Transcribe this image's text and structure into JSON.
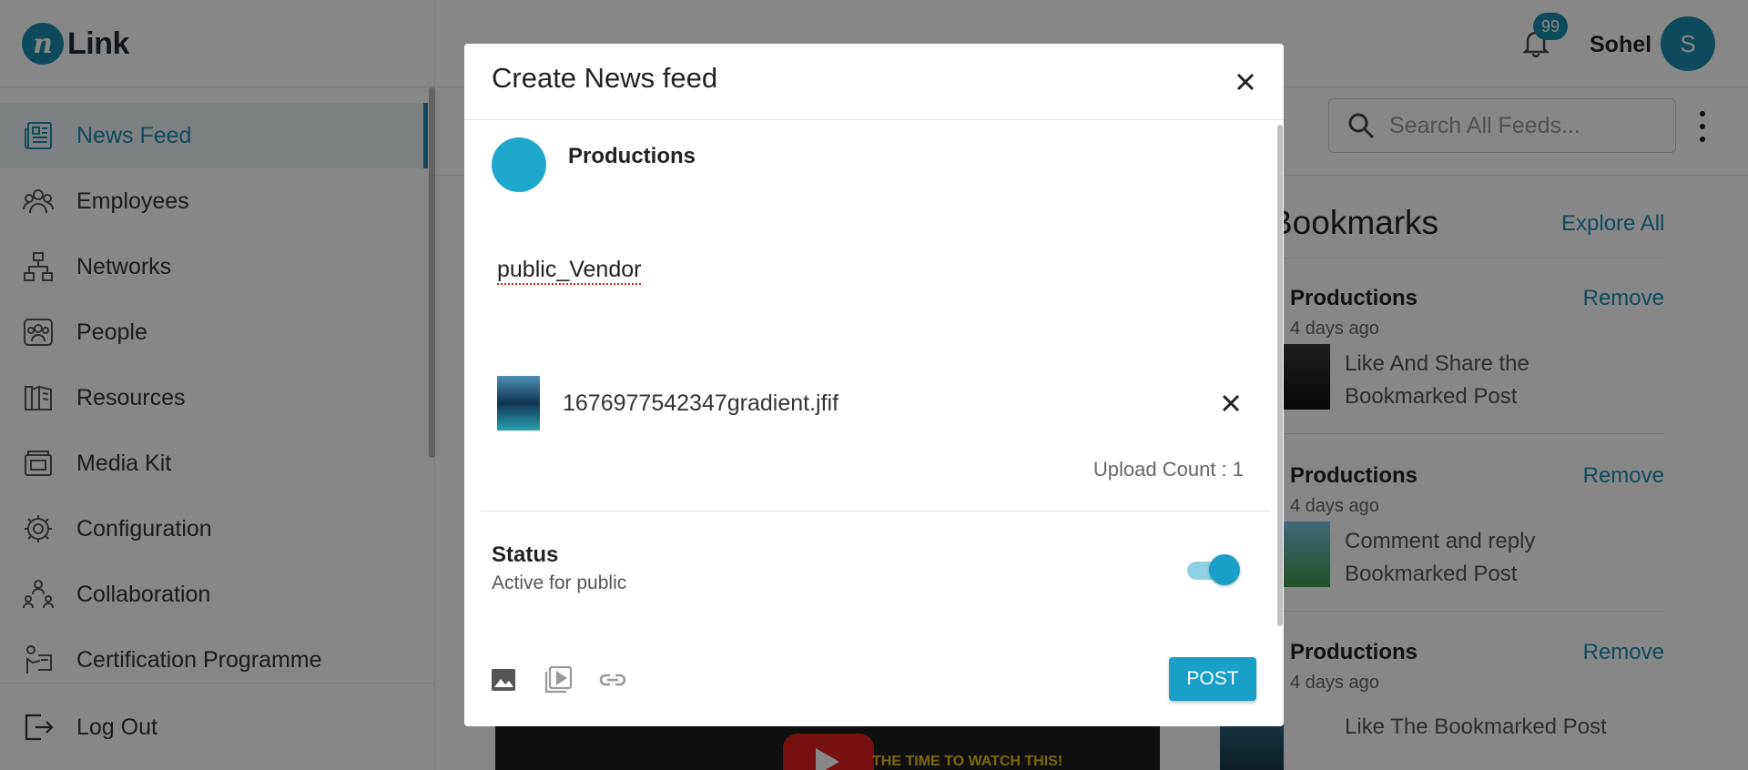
{
  "app": {
    "logo_text": "Link",
    "logo_mark": "n"
  },
  "sidebar": {
    "items": [
      {
        "label": "News Feed",
        "icon": "newspaper-icon",
        "active": true
      },
      {
        "label": "Employees",
        "icon": "employees-icon"
      },
      {
        "label": "Networks",
        "icon": "network-icon"
      },
      {
        "label": "People",
        "icon": "people-icon"
      },
      {
        "label": "Resources",
        "icon": "book-icon"
      },
      {
        "label": "Media Kit",
        "icon": "media-kit-icon"
      },
      {
        "label": "Configuration",
        "icon": "gear-icon"
      },
      {
        "label": "Collaboration",
        "icon": "collaboration-icon"
      },
      {
        "label": "Certification Programme",
        "icon": "certification-icon"
      }
    ],
    "logout_label": "Log Out"
  },
  "header": {
    "notification_count": "99",
    "username": "Sohel",
    "avatar_initial": "S"
  },
  "main": {
    "search_placeholder": "Search All Feeds...",
    "video_caption": "THE TIME TO WATCH THIS!"
  },
  "bookmarks": {
    "title": "Bookmarks",
    "explore_label": "Explore All",
    "items": [
      {
        "name": "Productions",
        "remove_label": "Remove",
        "time": "4 days ago",
        "text": "Like And Share the Bookmarked Post"
      },
      {
        "name": "Productions",
        "remove_label": "Remove",
        "time": "4 days ago",
        "text": "Comment and reply Bookmarked Post"
      },
      {
        "name": "Productions",
        "remove_label": "Remove",
        "time": "4 days ago",
        "text": "Like The Bookmarked Post"
      }
    ]
  },
  "modal": {
    "title": "Create News feed",
    "org_name": "Productions",
    "post_text": "public_Vendor",
    "attachment_name": "1676977542347gradient.jfif",
    "upload_count_label": "Upload Count : 1",
    "status_label": "Status",
    "status_sub": "Active for public",
    "status_on": true,
    "post_button": "POST"
  },
  "colors": {
    "accent": "#1a8fae",
    "button": "#1a9fc8",
    "overlay": "rgba(0,0,0,0.47)"
  }
}
